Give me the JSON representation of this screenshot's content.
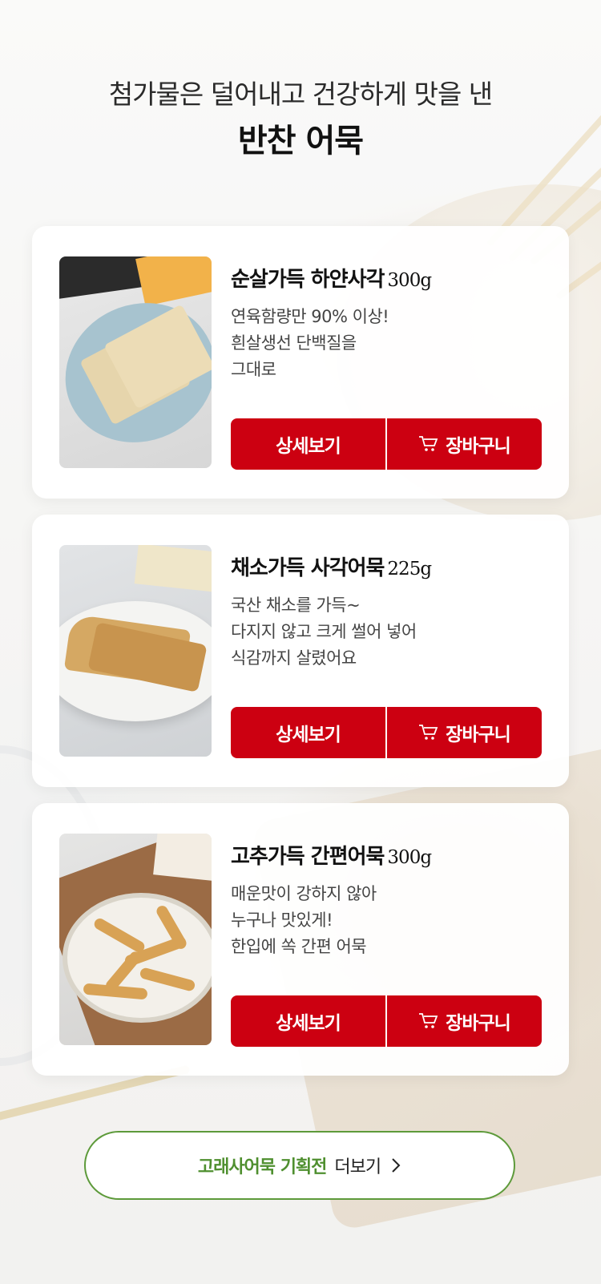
{
  "heading": {
    "subtitle": "첨가물은 덜어내고 건강하게 맛을 낸",
    "title": "반찬 어묵"
  },
  "products": [
    {
      "name": "순살가득 하얀사각",
      "weight": "300g",
      "description": "연육함량만 90% 이상!\n흰살생선 단백질을\n그대로",
      "detail_label": "상세보기",
      "cart_label": "장바구니"
    },
    {
      "name": "채소가득 사각어묵",
      "weight": "225g",
      "description": "국산 채소를 가득~\n다지지 않고 크게 썰어 넣어\n식감까지 살렸어요",
      "detail_label": "상세보기",
      "cart_label": "장바구니"
    },
    {
      "name": "고추가득 간편어묵",
      "weight": "300g",
      "description": "매운맛이 강하지 않아\n누구나 맛있게!\n한입에 쏙 간편 어묵",
      "detail_label": "상세보기",
      "cart_label": "장바구니"
    }
  ],
  "more": {
    "brand_label": "고래사어묵 기획전",
    "action_label": "더보기"
  },
  "colors": {
    "button_red": "#cc0011",
    "more_green": "#4f8f2f"
  },
  "icons": {
    "cart": "cart-icon",
    "more": "chevron-right-icon"
  }
}
